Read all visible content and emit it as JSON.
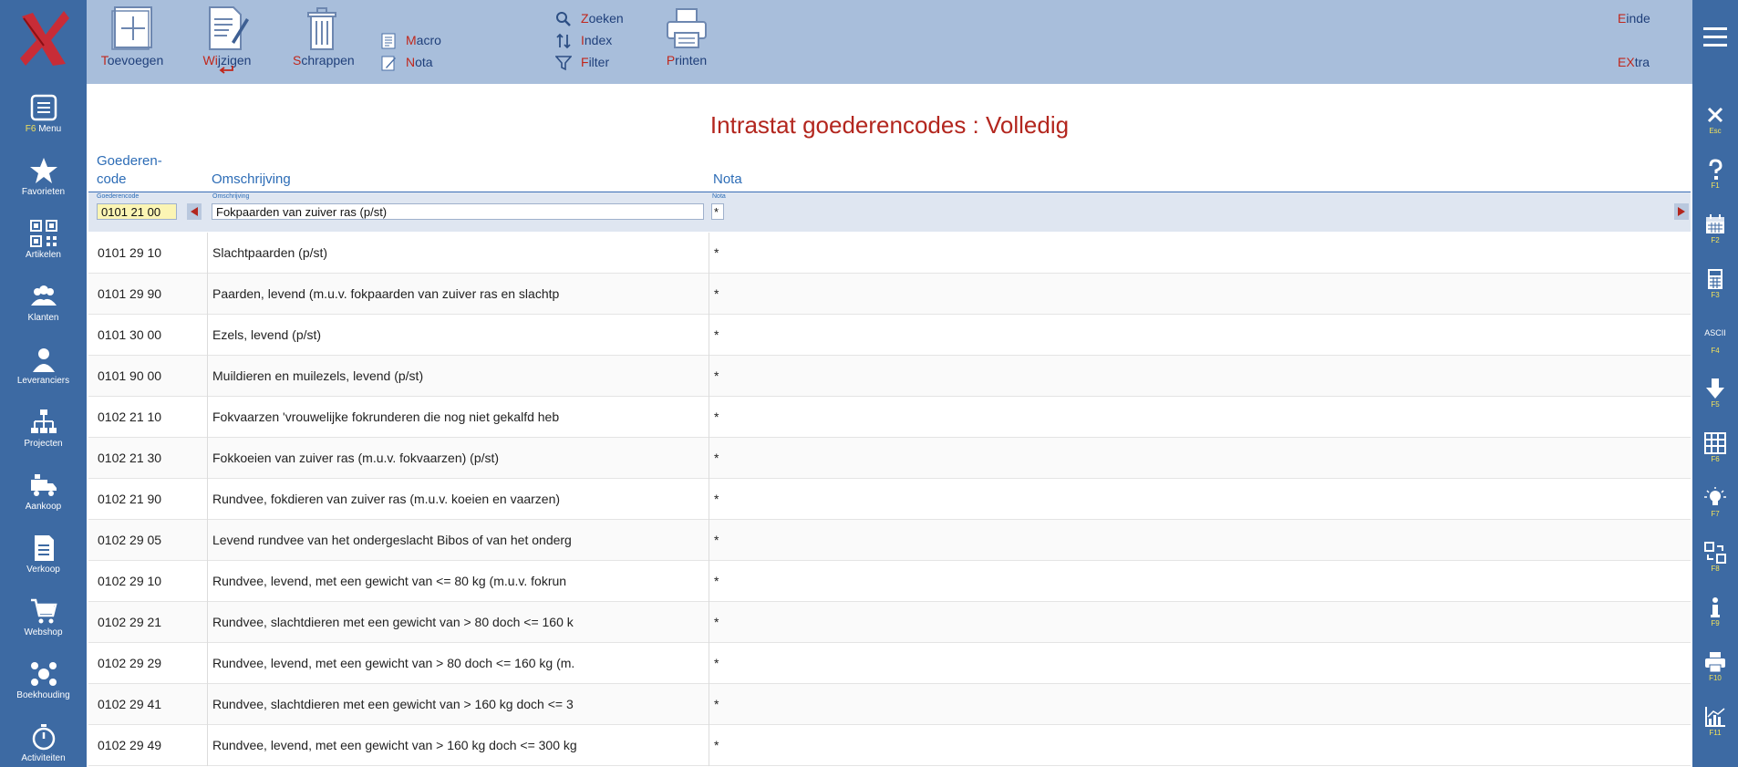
{
  "left_nav": {
    "items": [
      {
        "key": "F6",
        "label": "Menu",
        "icon": "menu-icon"
      },
      {
        "key": "",
        "label": "Favorieten",
        "icon": "star-icon"
      },
      {
        "key": "",
        "label": "Artikelen",
        "icon": "qr-code-icon"
      },
      {
        "key": "",
        "label": "Klanten",
        "icon": "people-icon"
      },
      {
        "key": "",
        "label": "Leveranciers",
        "icon": "person-icon"
      },
      {
        "key": "",
        "label": "Projecten",
        "icon": "org-chart-icon"
      },
      {
        "key": "",
        "label": "Aankoop",
        "icon": "truck-icon"
      },
      {
        "key": "",
        "label": "Verkoop",
        "icon": "document-icon"
      },
      {
        "key": "",
        "label": "Webshop",
        "icon": "cart-icon"
      },
      {
        "key": "",
        "label": "Boekhouding",
        "icon": "network-icon"
      },
      {
        "key": "",
        "label": "Activiteiten",
        "icon": "stopwatch-icon"
      }
    ]
  },
  "toolbar": {
    "toevoegen": {
      "hotkey": "T",
      "rest": "oevoegen"
    },
    "wijzigen": {
      "hotkey": "Wi",
      "rest": "jzigen"
    },
    "schrappen": {
      "hotkey": "S",
      "rest": "chrappen"
    },
    "macro": {
      "hotkey": "M",
      "rest": "acro"
    },
    "nota": {
      "hotkey": "N",
      "rest": "ota"
    },
    "zoeken": {
      "hotkey": "Z",
      "rest": "oeken"
    },
    "index": {
      "hotkey": "I",
      "rest": "ndex"
    },
    "filter": {
      "hotkey": "F",
      "rest": "ilter"
    },
    "printen": {
      "hotkey": "P",
      "rest": "rinten"
    },
    "einde": {
      "hotkey": "E",
      "rest": "inde"
    },
    "extra": {
      "hotkey": "EX",
      "rest": "tra"
    }
  },
  "page_title": "Intrastat goederencodes : Volledig",
  "columns": {
    "code_line1": "Goederen-",
    "code_line2": "code",
    "description": "Omschrijving",
    "nota": "Nota"
  },
  "edit_row": {
    "code_label": "Goederencode",
    "code_value": "0101 21 00",
    "description_label": "Omschrijving",
    "description_value": "Fokpaarden van zuiver ras (p/st)",
    "nota_label": "Nota",
    "nota_value": "*"
  },
  "rows": [
    {
      "code": "0101 29 10",
      "description": "Slachtpaarden (p/st)",
      "nota": "*"
    },
    {
      "code": "0101 29 90",
      "description": "Paarden, levend (m.u.v. fokpaarden van zuiver ras en slachtp",
      "nota": "*"
    },
    {
      "code": "0101 30 00",
      "description": "Ezels, levend (p/st)",
      "nota": "*"
    },
    {
      "code": "0101 90 00",
      "description": "Muildieren en muilezels, levend (p/st)",
      "nota": "*"
    },
    {
      "code": "0102 21 10",
      "description": "Fokvaarzen 'vrouwelijke fokrunderen die nog niet gekalfd heb",
      "nota": "*"
    },
    {
      "code": "0102 21 30",
      "description": "Fokkoeien van zuiver ras (m.u.v. fokvaarzen) (p/st)",
      "nota": "*"
    },
    {
      "code": "0102 21 90",
      "description": "Rundvee, fokdieren van zuiver ras (m.u.v. koeien en vaarzen)",
      "nota": "*"
    },
    {
      "code": "0102 29 05",
      "description": "Levend rundvee van het ondergeslacht Bibos of van het onderg",
      "nota": "*"
    },
    {
      "code": "0102 29 10",
      "description": "Rundvee, levend, met een gewicht van <= 80 kg (m.u.v. fokrun",
      "nota": "*"
    },
    {
      "code": "0102 29 21",
      "description": "Rundvee, slachtdieren met een gewicht van > 80 doch <= 160 k",
      "nota": "*"
    },
    {
      "code": "0102 29 29",
      "description": "Rundvee, levend, met een gewicht van > 80 doch <= 160 kg (m.",
      "nota": "*"
    },
    {
      "code": "0102 29 41",
      "description": "Rundvee, slachtdieren met een gewicht van > 160 kg doch <= 3",
      "nota": "*"
    },
    {
      "code": "0102 29 49",
      "description": "Rundvee, levend, met een gewicht van > 160 kg doch <= 300 kg",
      "nota": "*"
    }
  ],
  "right_nav": {
    "items": [
      {
        "key": "Esc",
        "icon": "close-icon"
      },
      {
        "key": "F1",
        "icon": "help-icon"
      },
      {
        "key": "F2",
        "icon": "calendar-icon"
      },
      {
        "key": "F3",
        "icon": "calculator-icon"
      },
      {
        "key": "F4",
        "icon": "ascii-icon",
        "text": "ASCII"
      },
      {
        "key": "F5",
        "icon": "arrow-down-icon"
      },
      {
        "key": "F6",
        "icon": "grid-icon"
      },
      {
        "key": "F7",
        "icon": "lightbulb-icon"
      },
      {
        "key": "F8",
        "icon": "switch-icon"
      },
      {
        "key": "F9",
        "icon": "info-icon"
      },
      {
        "key": "F10",
        "icon": "printer-icon"
      },
      {
        "key": "F11",
        "icon": "chart-icon"
      }
    ]
  }
}
